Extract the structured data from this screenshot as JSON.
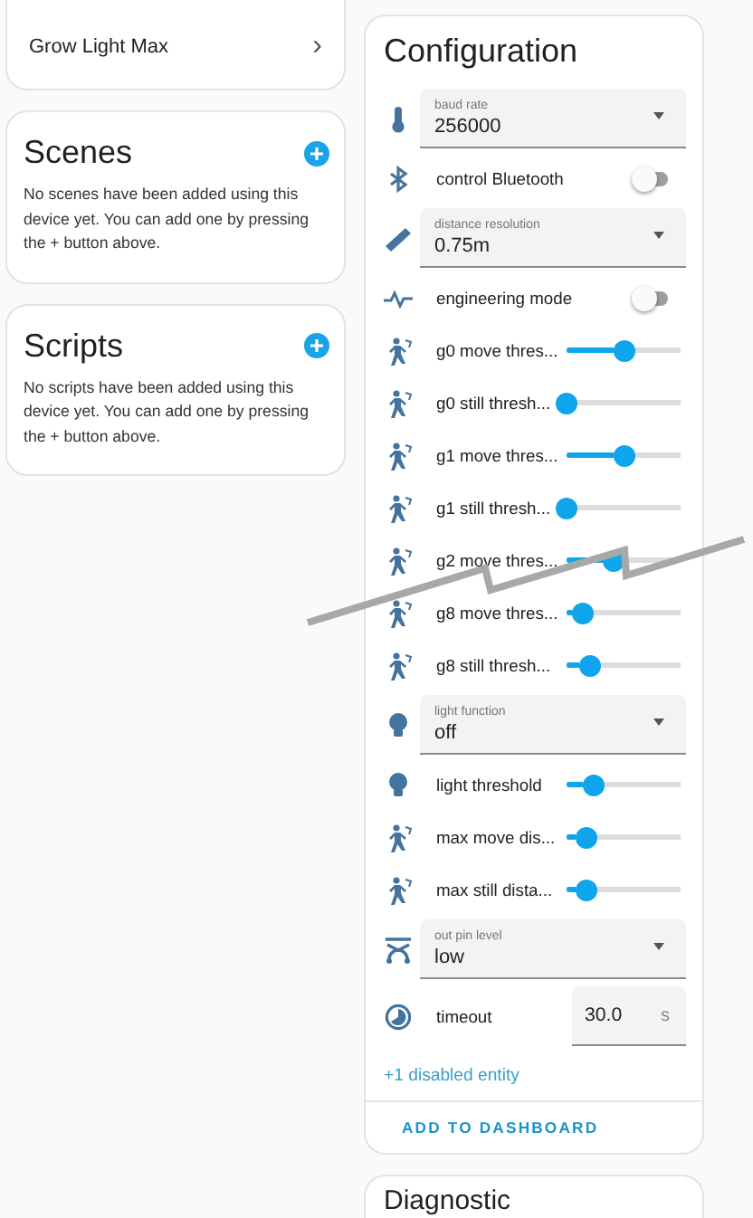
{
  "devices_card": {
    "items": [
      {
        "label": "Grow Light Max",
        "chevron": "›"
      }
    ]
  },
  "scenes": {
    "title": "Scenes",
    "message": "No scenes have been added using this device yet. You can add one by pressing the + button above."
  },
  "scripts": {
    "title": "Scripts",
    "message": "No scripts have been added using this device yet. You can add one by pressing the + button above."
  },
  "configuration": {
    "title": "Configuration",
    "rows": [
      {
        "kind": "select",
        "label": "baud rate",
        "value": "256000"
      },
      {
        "kind": "toggle",
        "label": "control Bluetooth",
        "on": false
      },
      {
        "kind": "select",
        "label": "distance resolution",
        "value": "0.75m"
      },
      {
        "kind": "toggle",
        "label": "engineering mode",
        "on": false
      },
      {
        "kind": "slider",
        "label": "g0 move thres...",
        "level": 0.51
      },
      {
        "kind": "slider",
        "label": "g0 still thresh...",
        "level": 0.0
      },
      {
        "kind": "slider",
        "label": "g1 move thres...",
        "level": 0.51
      },
      {
        "kind": "slider",
        "label": "g1 still thresh...",
        "level": 0.0
      },
      {
        "kind": "slider",
        "label": "g2 move thres...",
        "level": 0.41
      },
      {
        "kind": "slider",
        "label": "g8 move thres...",
        "level": 0.15
      },
      {
        "kind": "slider",
        "label": "g8 still thresh...",
        "level": 0.2
      },
      {
        "kind": "select",
        "label": "light function",
        "value": "off"
      },
      {
        "kind": "slider",
        "label": "light threshold",
        "level": 0.24
      },
      {
        "kind": "slider",
        "label": "max move dis...",
        "level": 0.17
      },
      {
        "kind": "slider",
        "label": "max still dista...",
        "level": 0.17
      },
      {
        "kind": "select",
        "label": "out pin level",
        "value": "low"
      },
      {
        "kind": "number",
        "label": "timeout",
        "value": "30.0",
        "unit": "s"
      }
    ],
    "disabled_link": "+1 disabled entity",
    "action": "ADD TO DASHBOARD"
  },
  "diagnostic": {
    "title": "Diagnostic"
  }
}
